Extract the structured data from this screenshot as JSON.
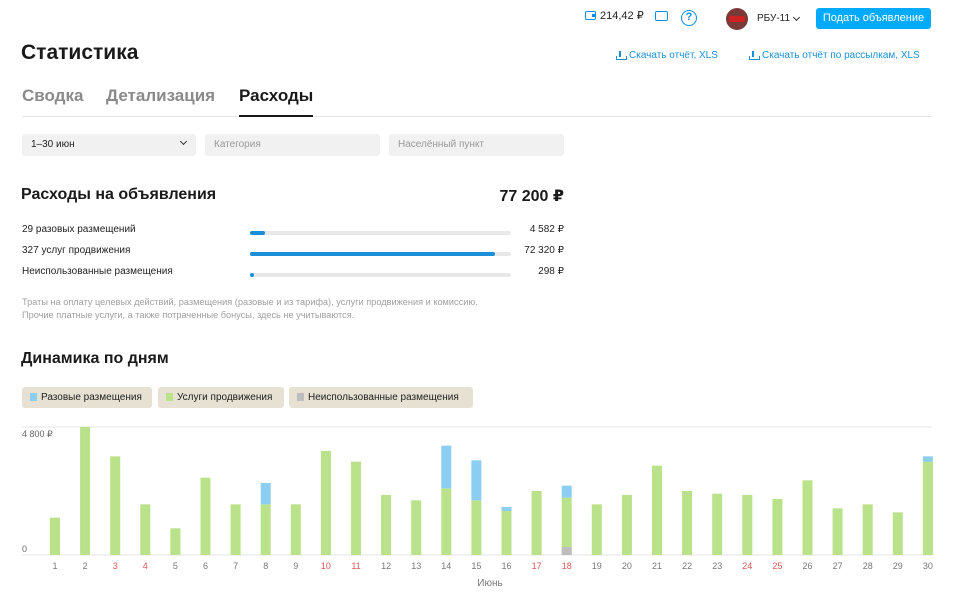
{
  "header": {
    "balance": "214,42 ₽",
    "user_name": "РБУ-11",
    "post_button": "Подать объявление",
    "icons": [
      "wallet-icon",
      "promo-icon",
      "help-icon",
      "avatar"
    ]
  },
  "page": {
    "title": "Статистика",
    "download_report": "Скачать отчёт, XLS",
    "download_mailing_report": "Скачать отчёт по рассылкам, XLS"
  },
  "tabs": [
    {
      "label": "Сводка",
      "active": false
    },
    {
      "label": "Детализация",
      "active": false
    },
    {
      "label": "Расходы",
      "active": true
    }
  ],
  "filters": {
    "period": "1–30 июн",
    "category_placeholder": "Категория",
    "city_placeholder": "Населённый пункт"
  },
  "expenses": {
    "title": "Расходы на объявления",
    "total": "77 200 ₽",
    "rows": [
      {
        "label": "29 разовых размещений",
        "value": "4 582 ₽",
        "share": 0.059
      },
      {
        "label": "327 услуг продвижения",
        "value": "72 320 ₽",
        "share": 0.937
      },
      {
        "label": "Неиспользованные размещения",
        "value": "298 ₽",
        "share": 0.004
      }
    ],
    "note_line1": "Траты на оплату целевых действий, размещения (разовые и из тарифа), услуги продвижения и комиссию.",
    "note_line2": "Прочие платные услуги, а также потраченные бонусы, здесь не учитываются."
  },
  "dynamics": {
    "title": "Динамика по дням",
    "legend": [
      {
        "label": "Разовые размещения",
        "color": "#8ccdf2"
      },
      {
        "label": "Услуги продвижения",
        "color": "#b9e28a"
      },
      {
        "label": "Неиспользованные размещения",
        "color": "#bdbdbd"
      }
    ]
  },
  "chart_data": {
    "type": "bar",
    "stacked": true,
    "y_tick_labels": [
      "4 800 ₽",
      "0"
    ],
    "ylim": [
      0,
      4800
    ],
    "xlabel": "Июнь",
    "categories": [
      "1",
      "2",
      "3",
      "4",
      "5",
      "6",
      "7",
      "8",
      "9",
      "10",
      "11",
      "12",
      "13",
      "14",
      "15",
      "16",
      "17",
      "18",
      "19",
      "20",
      "21",
      "22",
      "23",
      "24",
      "25",
      "26",
      "27",
      "28",
      "29",
      "30"
    ],
    "weekend_days": [
      "3",
      "4",
      "10",
      "11",
      "17",
      "18",
      "24",
      "25"
    ],
    "series": [
      {
        "name": "Разовые размещения",
        "color": "#8ccdf2",
        "values": [
          0,
          0,
          0,
          0,
          0,
          0,
          0,
          800,
          0,
          0,
          0,
          0,
          0,
          1600,
          1500,
          150,
          0,
          450,
          0,
          0,
          0,
          0,
          0,
          0,
          0,
          0,
          0,
          0,
          0,
          200
        ]
      },
      {
        "name": "Услуги продвижения",
        "color": "#b9e28a",
        "values": [
          1400,
          4800,
          3700,
          1900,
          1000,
          2900,
          1900,
          1900,
          1900,
          3900,
          3500,
          2250,
          2050,
          2500,
          2050,
          1650,
          2400,
          2150,
          1900,
          2250,
          3350,
          2400,
          2300,
          2250,
          2100,
          2800,
          1750,
          1900,
          1600,
          3500
        ]
      },
      {
        "name": "Неиспользованные размещения",
        "color": "#bdbdbd",
        "values": [
          0,
          0,
          0,
          0,
          0,
          0,
          0,
          0,
          0,
          0,
          0,
          0,
          0,
          0,
          0,
          0,
          0,
          300,
          0,
          0,
          0,
          0,
          0,
          0,
          0,
          0,
          0,
          0,
          0,
          0
        ]
      }
    ]
  }
}
